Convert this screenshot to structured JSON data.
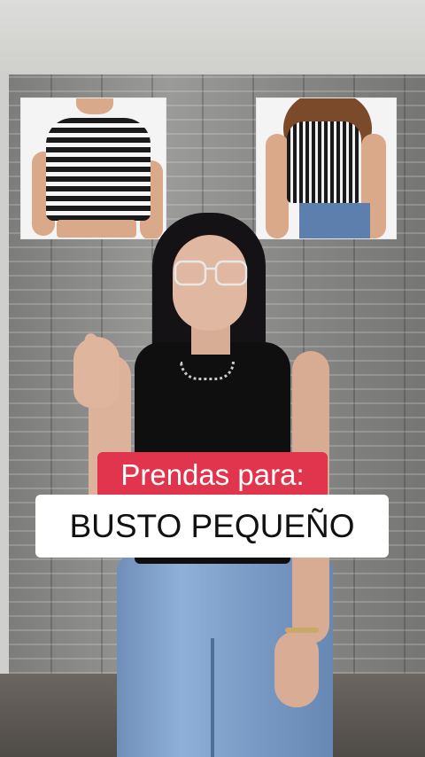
{
  "caption": {
    "line1": "Prendas para:",
    "line2": "BUSTO PEQUEÑO"
  },
  "colors": {
    "caption_red_bg": "#e1344d",
    "caption_white_bg": "#ffffff",
    "caption_text_dark": "#111111"
  },
  "product_images": [
    {
      "icon": "striped-crop-top-image"
    },
    {
      "icon": "striped-halter-top-image"
    }
  ]
}
